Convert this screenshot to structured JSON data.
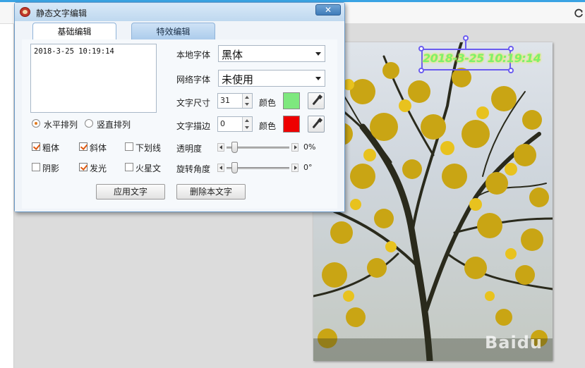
{
  "dialog": {
    "title": "静态文字编辑",
    "close_label": "✕"
  },
  "tabs": [
    {
      "label": "基础编辑",
      "active": true
    },
    {
      "label": "特效编辑",
      "active": false
    }
  ],
  "text_input": {
    "value": "2018-3-25 10:19:14"
  },
  "orientation": {
    "horizontal_label": "水平排列",
    "vertical_label": "竖直排列",
    "selected": "水平排列"
  },
  "styles": [
    {
      "label": "粗体",
      "checked": true
    },
    {
      "label": "斜体",
      "checked": true
    },
    {
      "label": "下划线",
      "checked": false
    },
    {
      "label": "阴影",
      "checked": false
    },
    {
      "label": "发光",
      "checked": true
    },
    {
      "label": "火星文",
      "checked": false
    }
  ],
  "font": {
    "local_label": "本地字体",
    "local_value": "黑体",
    "web_label": "网络字体",
    "web_value": "未使用"
  },
  "size": {
    "label": "文字尺寸",
    "value": "31",
    "color_label": "颜色",
    "color": "#7ee87e"
  },
  "stroke": {
    "label": "文字描边",
    "value": "0",
    "color_label": "颜色",
    "color": "#ee0000"
  },
  "opacity": {
    "label": "透明度",
    "value_text": "0%",
    "value": 0
  },
  "rotation": {
    "label": "旋转角度",
    "value_text": "0°",
    "value": 0
  },
  "buttons": {
    "apply": "应用文字",
    "delete": "删除本文字"
  },
  "overlay": {
    "text": "2018-3-25 10:19:14"
  },
  "watermark": {
    "text": "Baidu"
  },
  "icons": {
    "refresh": "refresh-icon",
    "picker": "eyedropper-icon",
    "app": "monkey-app-icon"
  }
}
